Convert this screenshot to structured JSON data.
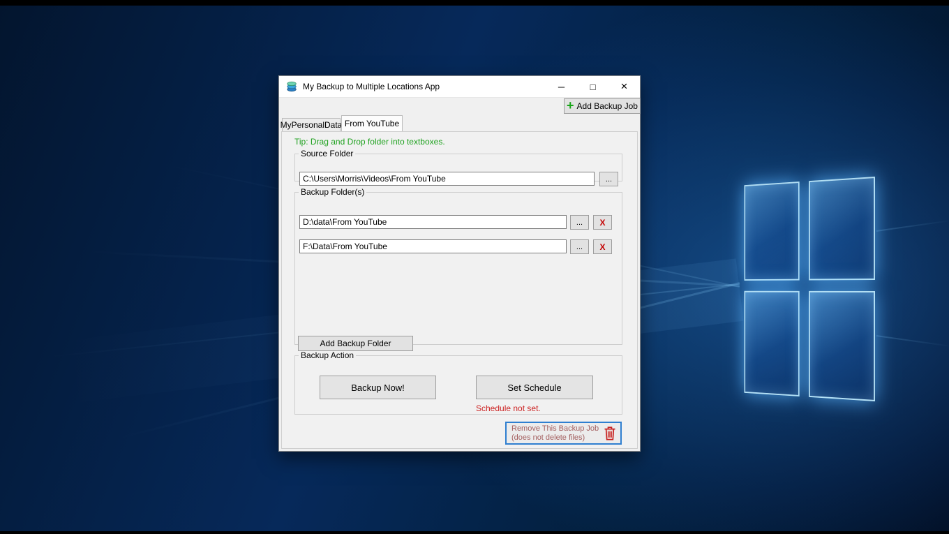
{
  "window": {
    "title": "My Backup to Multiple Locations App",
    "controls": {
      "minimize": "─",
      "maximize": "□",
      "close": "×"
    }
  },
  "toolbar": {
    "plus_glyph": "+",
    "add_backup_job": "Add Backup Job"
  },
  "tabs": [
    {
      "label": "MyPersonalData",
      "selected": false
    },
    {
      "label": "From YouTube",
      "selected": true
    }
  ],
  "tab_page": {
    "tip": "Tip: Drag and Drop folder into textboxes.",
    "source_folder": {
      "group_label": "Source Folder",
      "path": "C:\\Users\\Morris\\Videos\\From YouTube",
      "browse_label": "..."
    },
    "backup_folders": {
      "group_label": "Backup Folder(s)",
      "rows": [
        {
          "path": "D:\\data\\From YouTube",
          "browse_label": "...",
          "delete_label": "X"
        },
        {
          "path": "F:\\Data\\From YouTube",
          "browse_label": "...",
          "delete_label": "X"
        }
      ],
      "add_button": "Add Backup Folder"
    },
    "backup_action": {
      "group_label": "Backup Action",
      "backup_now": "Backup Now!",
      "set_schedule": "Set Schedule",
      "schedule_status": "Schedule not set."
    },
    "remove_job": {
      "line1": "Remove This Backup Job",
      "line2": "(does not delete files)"
    }
  },
  "colors": {
    "tip_text": "#1ea11e",
    "schedule_warning": "#cc2222",
    "delete_x": "#c40000",
    "add_plus": "#17a517",
    "remove_button_border": "#2f7fd0",
    "remove_button_text": "#a35f5f",
    "titlebar_bg": "#ffffff",
    "client_bg": "#f0f0f0",
    "wallpaper_base": "#03152e",
    "wallpaper_glow": "#2d87eb"
  }
}
